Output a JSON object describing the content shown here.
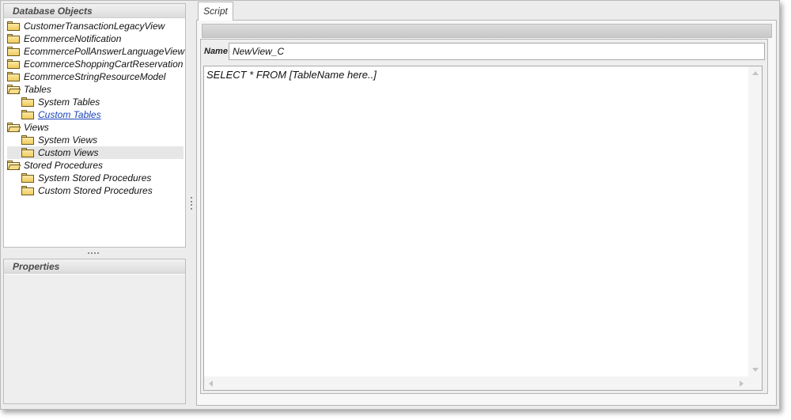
{
  "panels": {
    "database_objects": {
      "title": "Database Objects"
    },
    "properties": {
      "title": "Properties"
    }
  },
  "tree": {
    "items": [
      {
        "label": "CustomerTransactionLegacyView",
        "icon": "folder-icon"
      },
      {
        "label": "EcommerceNotification",
        "icon": "folder-icon"
      },
      {
        "label": "EcommercePollAnswerLanguageView",
        "icon": "folder-icon"
      },
      {
        "label": "EcommerceShoppingCartReservation",
        "icon": "folder-icon"
      },
      {
        "label": "EcommerceStringResourceModel",
        "icon": "folder-icon"
      },
      {
        "label": "Tables",
        "icon": "folder-open-icon"
      },
      {
        "label": "System Tables",
        "icon": "folder-icon"
      },
      {
        "label": "Custom Tables",
        "icon": "folder-icon"
      },
      {
        "label": "Views",
        "icon": "folder-open-icon"
      },
      {
        "label": "System Views",
        "icon": "folder-icon"
      },
      {
        "label": "Custom Views",
        "icon": "folder-icon"
      },
      {
        "label": "Stored Procedures",
        "icon": "folder-open-icon"
      },
      {
        "label": "System Stored Procedures",
        "icon": "folder-icon"
      },
      {
        "label": "Custom Stored Procedures",
        "icon": "folder-icon"
      }
    ]
  },
  "tabs": [
    {
      "label": "Script"
    }
  ],
  "script": {
    "name_label": "Name",
    "name_value": "NewView_C",
    "sql": "SELECT * FROM [TableName here..]"
  },
  "colors": {
    "link": "#1a44b8",
    "folder": "#f5d77c",
    "selection": "#e6e6e6"
  }
}
